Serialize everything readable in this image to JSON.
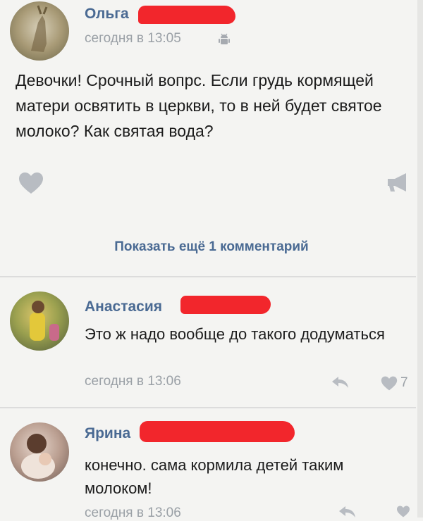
{
  "post": {
    "author": "Ольга",
    "time": "сегодня в 13:05",
    "text": "Девочки! Срочный вопрс. Если грудь кормящей матери освятить в церкви, то в ней будет святое молоко? Как святая вода?"
  },
  "show_more_label": "Показать ещё 1 комментарий",
  "comments": [
    {
      "author": "Анастасия",
      "text": "Это ж надо вообще до такого додуматься",
      "time": "сегодня в 13:06",
      "likes": "7"
    },
    {
      "author": "Ярина",
      "text": "конечно. сама кормила детей таким молоком!",
      "time": "сегодня в 13:06"
    }
  ],
  "colors": {
    "accent": "#4a6a93",
    "meta": "#9aa0a6",
    "redaction": "#f2262c",
    "background": "#f4f4f2"
  },
  "icons": [
    "android-icon",
    "heart-icon",
    "megaphone-icon",
    "reply-icon"
  ]
}
